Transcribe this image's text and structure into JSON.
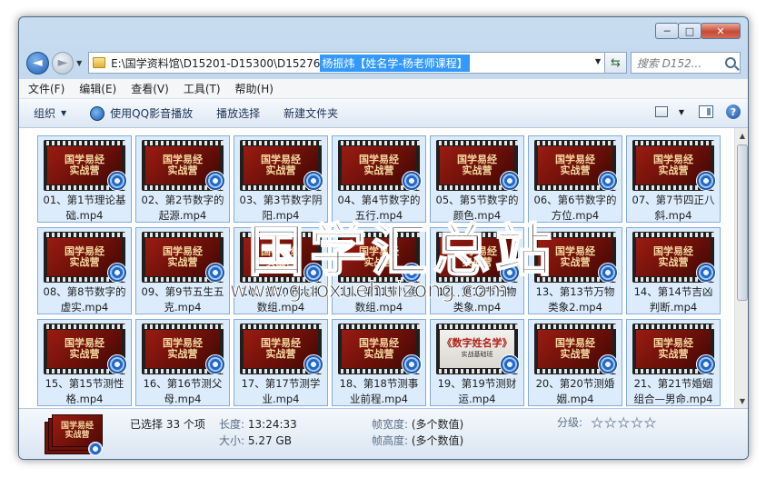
{
  "window": {
    "buttons": {
      "minimize": "─",
      "maximize": "□",
      "close": "✕"
    }
  },
  "nav": {
    "back_icon": "◄",
    "forward_icon": "►",
    "address_path": "E:\\国学资料馆\\D15201-D15300\\D15276",
    "address_selected": "杨振炜【姓名学-杨老师课程】",
    "search_placeholder": "搜索 D152..."
  },
  "menu": [
    "文件(F)",
    "编辑(E)",
    "查看(V)",
    "工具(T)",
    "帮助(H)"
  ],
  "toolbar": {
    "organize": "组织",
    "qq_play": "使用QQ影音播放",
    "play_selection": "播放选择",
    "new_folder": "新建文件夹",
    "help": "?"
  },
  "thumbnail": {
    "line1": "国学易经",
    "line2": "实战营",
    "light_line1": "《数字姓名学》",
    "light_line2": "实战基础班"
  },
  "files": [
    {
      "name": "01、第1节理论基础.mp4"
    },
    {
      "name": "02、第2节数字的起源.mp4"
    },
    {
      "name": "03、第3节数字阴阳.mp4"
    },
    {
      "name": "04、第4节数字的五行.mp4"
    },
    {
      "name": "05、第5节数字的颜色.mp4"
    },
    {
      "name": "06、第6节数字的方位.mp4"
    },
    {
      "name": "07、第7节四正八斜.mp4"
    },
    {
      "name": "08、第8节数字的虚实.mp4"
    },
    {
      "name": "09、第9节五生五克.mp4"
    },
    {
      "name": "10、第10节六冲数组.mp4"
    },
    {
      "name": "11、第11节八绝数组.mp4"
    },
    {
      "name": "12、第12节万物类象.mp4"
    },
    {
      "name": "13、第13节万物类象2.mp4"
    },
    {
      "name": "14、第14节吉凶判断.mp4"
    },
    {
      "name": "15、第15节测性格.mp4"
    },
    {
      "name": "16、第16节测父母.mp4"
    },
    {
      "name": "17、第17节测学业.mp4"
    },
    {
      "name": "18、第18节测事业前程.mp4"
    },
    {
      "name": "19、第19节测财运.mp4",
      "light": true
    },
    {
      "name": "20、第20节测婚姻.mp4"
    },
    {
      "name": "21、第21节婚姻组合—男命.mp4"
    }
  ],
  "watermark": {
    "cn": "国学汇总站",
    "url": "www.guoxuehuizong.com"
  },
  "details": {
    "selected": "已选择 33 个项",
    "length_key": "长度:",
    "length_val": "13:24:33",
    "size_key": "大小:",
    "size_val": "5.27 GB",
    "width_key": "帧宽度:",
    "width_val": "(多个数值)",
    "height_key": "帧高度:",
    "height_val": "(多个数值)",
    "rating_key": "分级:"
  }
}
